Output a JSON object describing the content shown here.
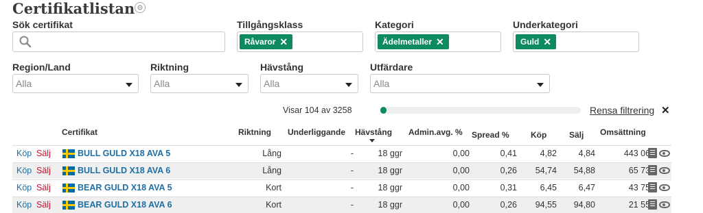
{
  "page": {
    "title": "Certifikatlistan",
    "title_icon": "target-icon"
  },
  "filters": {
    "search": {
      "label": "Sök certifikat",
      "placeholder": ""
    },
    "asset_class": {
      "label": "Tillgångsklass",
      "chip": "Råvaror"
    },
    "category": {
      "label": "Kategori",
      "chip": "Ädelmetaller"
    },
    "subcategory": {
      "label": "Underkategori",
      "chip": "Guld"
    },
    "region": {
      "label": "Region/Land",
      "value": "Alla"
    },
    "direction": {
      "label": "Riktning",
      "value": "Alla"
    },
    "leverage": {
      "label": "Hävstång",
      "value": "Alla"
    },
    "issuer": {
      "label": "Utfärdare",
      "value": "Alla"
    }
  },
  "results": {
    "showing": "Visar 104 av 3258",
    "progress": 0.032,
    "reset_label": "Rensa filtrering"
  },
  "table": {
    "headers": {
      "certificate": "Certifikat",
      "direction": "Riktning",
      "underlying": "Underliggande",
      "leverage": "Hävstång",
      "admin_fee": "Admin.avg. %",
      "spread": "Spread %",
      "buy": "Köp",
      "sell": "Sälj",
      "turnover": "Omsättning"
    },
    "actions": {
      "buy": "Köp",
      "sell": "Sälj"
    },
    "rows": [
      {
        "name": "BULL GULD X18 AVA 5",
        "direction": "Lång",
        "underlying": "-",
        "leverage": "18 ggr",
        "admin_fee": "0,00",
        "spread": "0,41",
        "buy": "4,82",
        "sell": "4,84",
        "turnover": "443 066"
      },
      {
        "name": "BULL GULD X18 AVA 6",
        "direction": "Lång",
        "underlying": "-",
        "leverage": "18 ggr",
        "admin_fee": "0,00",
        "spread": "0,26",
        "buy": "54,74",
        "sell": "54,88",
        "turnover": "65 737"
      },
      {
        "name": "BEAR GULD X18 AVA 5",
        "direction": "Kort",
        "underlying": "-",
        "leverage": "18 ggr",
        "admin_fee": "0,00",
        "spread": "0,31",
        "buy": "6,45",
        "sell": "6,47",
        "turnover": "43 759"
      },
      {
        "name": "BEAR GULD X18 AVA 6",
        "direction": "Kort",
        "underlying": "-",
        "leverage": "18 ggr",
        "admin_fee": "0,00",
        "spread": "0,26",
        "buy": "94,55",
        "sell": "94,80",
        "turnover": "21 554"
      }
    ]
  },
  "colors": {
    "accent": "#0e8a5f",
    "link": "#1d6fa5",
    "sell": "#c8102e"
  }
}
